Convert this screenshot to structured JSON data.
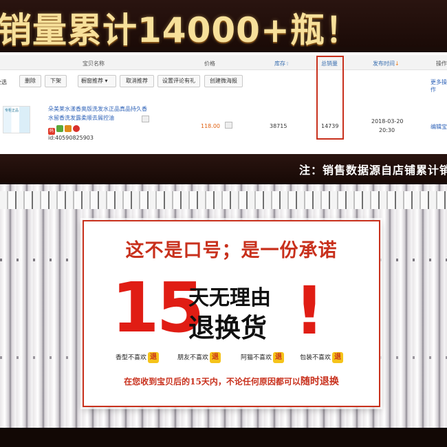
{
  "banner": {
    "headline": "销量累计14000+瓶！"
  },
  "table": {
    "headers": {
      "name": "宝贝名称",
      "price": "价格",
      "stock": "库存",
      "sales": "总销量",
      "publish": "发布时间",
      "ops": "操作"
    },
    "toolbar": {
      "select_all": "全选",
      "delete": "删除",
      "delist": "下架",
      "recommend": "橱窗推荐",
      "cancel_recommend": "取消推荐",
      "set_reviews": "设置评论有礼",
      "create_poster": "创建微海报",
      "more": "更多操作"
    },
    "row": {
      "title_line1": "朵美莱水漾香奥版洗发水正品真品持久香",
      "title_line2": "水留香洗发露柔顺去屑控油",
      "thumb_label": "专柜正品",
      "badge_code": "码",
      "id_text": "id:40590825903",
      "price": "118.00",
      "stock": "38715",
      "sales": "14739",
      "date": "2018-03-20",
      "time": "20:30",
      "edit": "编辑宝"
    }
  },
  "notice": {
    "text": "注：销售数据源自店铺累计销"
  },
  "promise": {
    "slogan": "这不是口号；是一份承诺",
    "days": "15",
    "line1": "天无理由",
    "line2": "退换货",
    "exclaim": "!",
    "reasons": [
      {
        "text": "香型不喜欢",
        "badge": "退"
      },
      {
        "text": "朋友不喜欢",
        "badge": "退"
      },
      {
        "text": "阿猫不喜欢",
        "badge": "退"
      },
      {
        "text": "包装不喜欢",
        "badge": "退"
      }
    ],
    "footer_main": "在您收到宝贝后的15天内，不论任何原因都可以",
    "footer_emph": "随时退换"
  },
  "colors": {
    "accent_red": "#c8301c",
    "gold": "#f7e09a",
    "link_blue": "#2f63b8"
  }
}
